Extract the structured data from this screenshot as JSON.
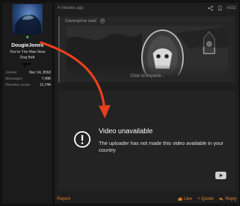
{
  "user": {
    "name": "DougieJones",
    "title_line1": "You're The Man Now",
    "title_line2": "Dog Belt",
    "stats": [
      {
        "label": "Joined:",
        "value": "Dec 14, 2018"
      },
      {
        "label": "Messages:",
        "value": "7,490"
      },
      {
        "label": "Reaction score:",
        "value": "11,744"
      }
    ]
  },
  "post": {
    "timestamp": "4 minutes ago",
    "post_number": "#102",
    "quote": {
      "author_said": "Danespina said:",
      "expand_label": "Click to expand..."
    },
    "video": {
      "title": "Video unavailable",
      "message": "The uploader has not made this video available in your country"
    },
    "footer": {
      "report_label": "Report",
      "like_label": "Like",
      "quote_label": "+ Quote",
      "reply_label": "Reply"
    }
  },
  "colors": {
    "accent": "#e4832b",
    "annotation_arrow": "#e8401c",
    "online": "#2ea44f"
  },
  "icons": [
    "share-icon",
    "bookmark-icon",
    "quote-arrow-icon",
    "alert-circle-icon",
    "youtube-icon",
    "like-icon",
    "reply-icon"
  ]
}
